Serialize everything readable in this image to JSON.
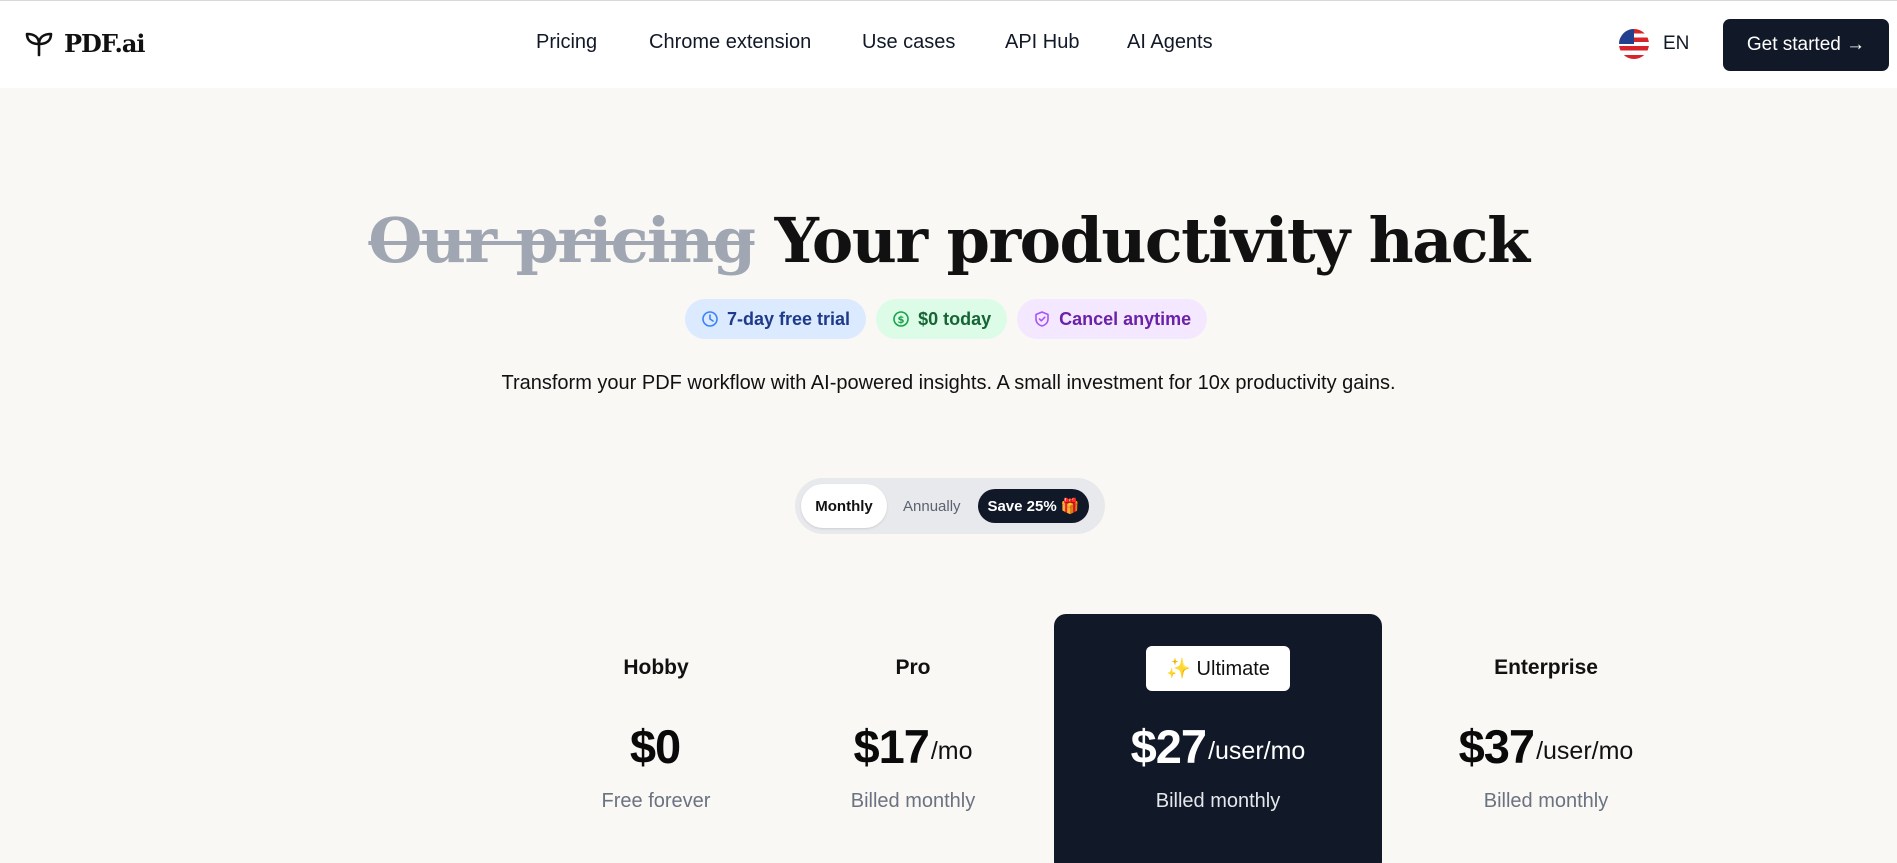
{
  "header": {
    "logo_text": "PDF.ai",
    "nav": [
      "Pricing",
      "Chrome extension",
      "Use cases",
      "API Hub",
      "AI Agents"
    ],
    "language": "EN",
    "cta_label": "Get started →"
  },
  "hero": {
    "headline_struck": "Our pricing",
    "headline_main": "Your productivity hack",
    "chips": [
      {
        "label": "7-day free trial",
        "icon": "clock-icon",
        "color": "#1e3a8a"
      },
      {
        "label": "$0 today",
        "icon": "dollar-circle-icon",
        "color": "#166534"
      },
      {
        "label": "Cancel anytime",
        "icon": "shield-icon",
        "color": "#6b21a8"
      }
    ],
    "subtitle": "Transform your PDF workflow with AI-powered insights. A small investment for 10x productivity gains."
  },
  "billing_toggle": {
    "monthly_label": "Monthly",
    "annually_label": "Annually",
    "save_label": "Save 25% 🎁",
    "selected": "Monthly"
  },
  "plans": [
    {
      "name": "Hobby",
      "price": "$0",
      "period": "",
      "billing": "Free forever"
    },
    {
      "name": "Pro",
      "price": "$17",
      "period": "/mo",
      "billing": "Billed monthly"
    },
    {
      "name": "✨ Ultimate",
      "price": "$27",
      "period": "/user/mo",
      "billing": "Billed monthly",
      "highlighted": true
    },
    {
      "name": "Enterprise",
      "price": "$37",
      "period": "/user/mo",
      "billing": "Billed monthly"
    }
  ],
  "colors": {
    "primary_dark": "#111827",
    "background": "#f9f8f5"
  }
}
